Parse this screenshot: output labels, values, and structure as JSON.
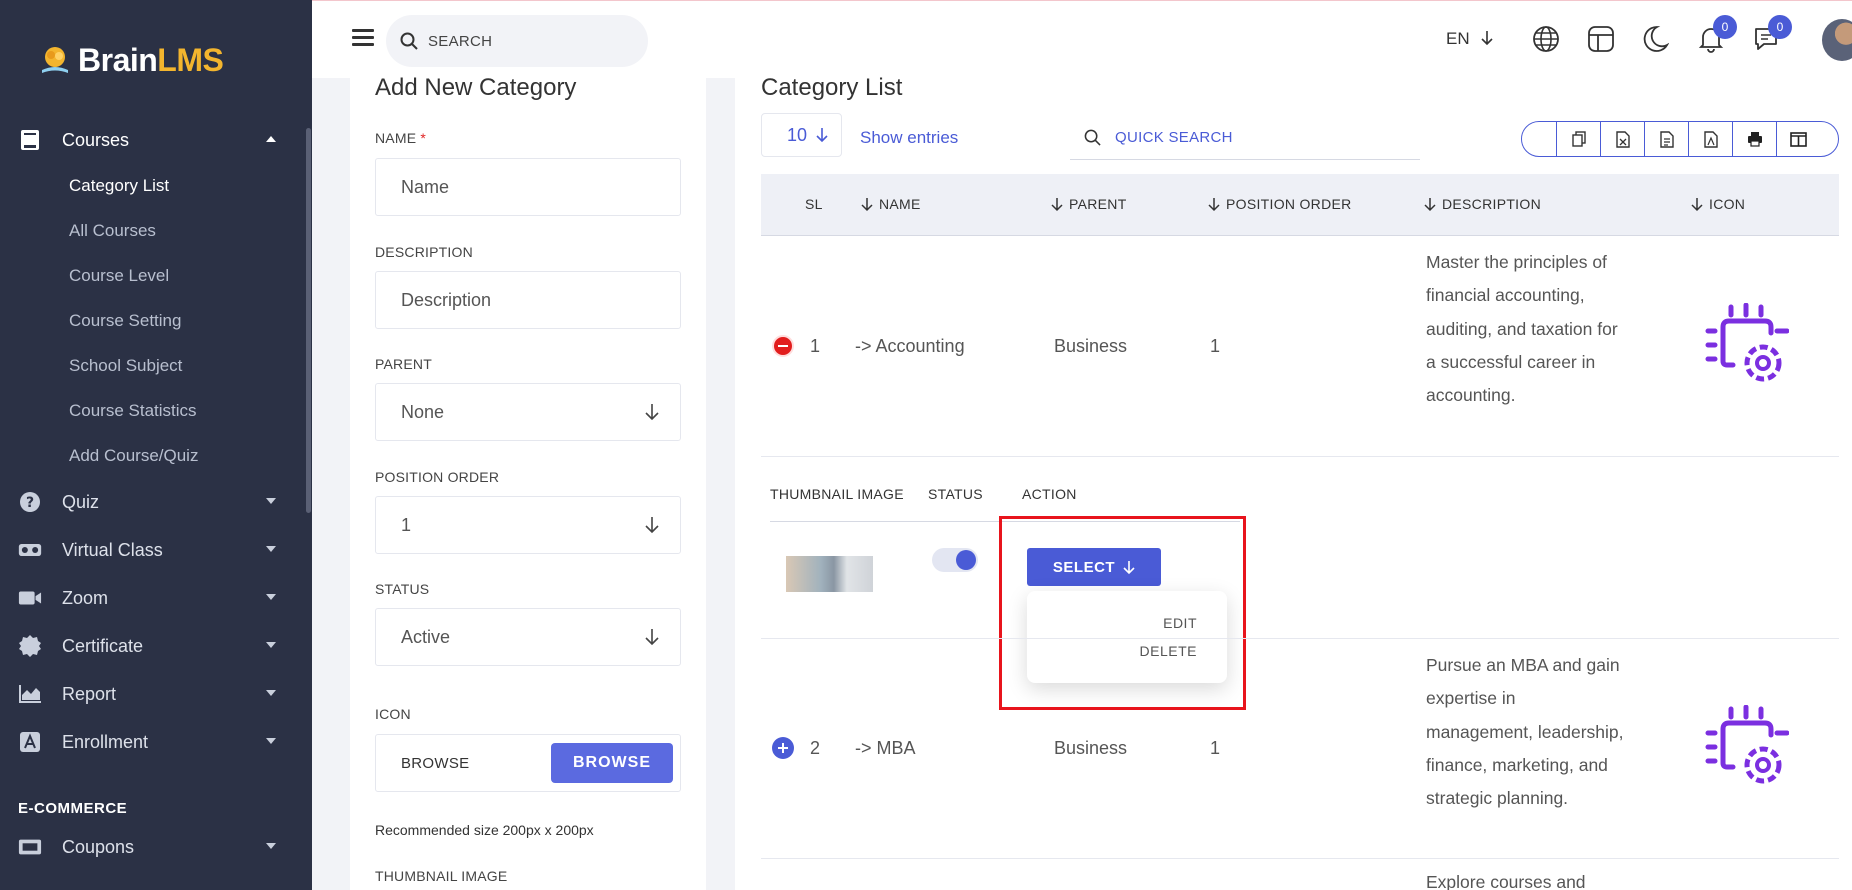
{
  "brand": {
    "name_main": "Brain",
    "name_accent": "LMS"
  },
  "sidebar": {
    "courses": {
      "label": "Courses",
      "sub": [
        "Category List",
        "All Courses",
        "Course Level",
        "Course Setting",
        "School Subject",
        "Course Statistics",
        "Add Course/Quiz"
      ]
    },
    "items": [
      {
        "label": "Quiz",
        "icon": "question-circle-icon"
      },
      {
        "label": "Virtual Class",
        "icon": "vr-headset-icon"
      },
      {
        "label": "Zoom",
        "icon": "video-camera-icon"
      },
      {
        "label": "Certificate",
        "icon": "badge-icon"
      },
      {
        "label": "Report",
        "icon": "area-chart-icon"
      },
      {
        "label": "Enrollment",
        "icon": "enrollment-icon"
      }
    ],
    "section": "E-COMMERCE",
    "coupons": {
      "label": "Coupons",
      "icon": "ticket-icon"
    }
  },
  "topbar": {
    "search_placeholder": "SEARCH",
    "language": "EN",
    "notifications_count": "0",
    "messages_count": "0"
  },
  "form": {
    "title": "Add New Category",
    "name_label": "NAME",
    "name_required": "*",
    "name_placeholder": "Name",
    "description_label": "DESCRIPTION",
    "description_placeholder": "Description",
    "parent_label": "PARENT",
    "parent_value": "None",
    "position_label": "POSITION ORDER",
    "position_value": "1",
    "status_label": "STATUS",
    "status_value": "Active",
    "icon_label": "ICON",
    "browse_text": "BROWSE",
    "browse_button": "BROWSE",
    "hint": "Recommended size 200px x 200px",
    "thumbnail_label": "THUMBNAIL IMAGE"
  },
  "list": {
    "title": "Category List",
    "entries_value": "10",
    "show_entries": "Show entries",
    "quick_search": "QUICK SEARCH",
    "columns": [
      "SL",
      "NAME",
      "PARENT",
      "POSITION ORDER",
      "DESCRIPTION",
      "ICON"
    ],
    "rows": [
      {
        "sl": "1",
        "name": "-> Accounting",
        "parent": "Business",
        "position": "1",
        "description": "Master the principles of financial accounting, auditing, and taxation for a successful career in accounting.",
        "expanded": true
      },
      {
        "sl": "2",
        "name": "-> MBA",
        "parent": "Business",
        "position": "1",
        "description": "Pursue an MBA and gain expertise in management, leadership, finance, marketing, and strategic planning.",
        "expanded": false
      }
    ],
    "row3_description_partial": "Explore courses and",
    "detail_columns": [
      "THUMBNAIL IMAGE",
      "STATUS",
      "ACTION"
    ],
    "status_active": true,
    "select_button": "SELECT",
    "dropdown": [
      "EDIT",
      "DELETE"
    ]
  },
  "colors": {
    "accent": "#4a5bd6",
    "sidebar_bg": "#2b3145",
    "icon_purple": "#7b2fe0",
    "highlight": "#e8141c"
  }
}
